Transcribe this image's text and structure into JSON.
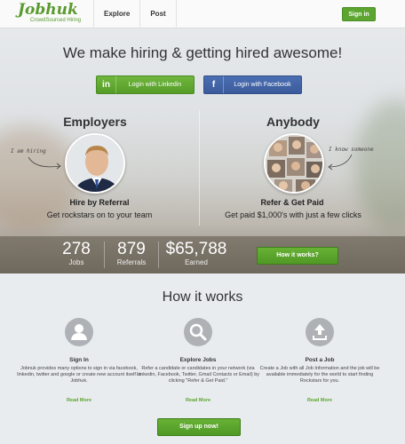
{
  "header": {
    "logo_text": "Jobhuk",
    "logo_tagline": "CrowdSourced Hiring",
    "nav": [
      "Explore",
      "Post"
    ],
    "signin_label": "Sign in"
  },
  "hero": {
    "title": "We make hiring & getting hired awesome!",
    "linkedin_label": "Login with Linkedin",
    "linkedin_icon": "in",
    "facebook_label": "Login with Facebook",
    "facebook_icon": "f",
    "employers": {
      "title": "Employers",
      "note": "I am hiring",
      "subtitle": "Hire by Referral",
      "desc": "Get rockstars on to your team"
    },
    "anybody": {
      "title": "Anybody",
      "note": "I know someone",
      "subtitle": "Refer & Get Paid",
      "desc": "Get paid $1,000's with just a few clicks"
    }
  },
  "stats": {
    "jobs": {
      "value": "278",
      "label": "Jobs"
    },
    "referrals": {
      "value": "879",
      "label": "Referrals"
    },
    "earned": {
      "value": "$65,788",
      "label": "Earned"
    },
    "how_button": "How it works?"
  },
  "how": {
    "title": "How it works",
    "steps": [
      {
        "icon": "user-icon",
        "title": "Sign In",
        "desc": "Jobnuk provides many options to sign in via facebook, linkedin, twitter and google or create new account itself in Jobhuk.",
        "more": "Read More"
      },
      {
        "icon": "search-icon",
        "title": "Explore Jobs",
        "desc": "Refer a candidate or candidates in your network (via Linkedin, Facebook, Twitter, Gmail Contacts or Email) by clicking \"Refer & Get Paid.\"",
        "more": "Read More"
      },
      {
        "icon": "upload-icon",
        "title": "Post a Job",
        "desc": "Create a Job with all Job Information and the job will be available immediately for the world to start finding Rockstars for you.",
        "more": "Read More"
      }
    ],
    "signup_label": "Sign up now!"
  },
  "colors": {
    "brand_green": "#5ca530",
    "facebook_blue": "#3b5b9b"
  }
}
